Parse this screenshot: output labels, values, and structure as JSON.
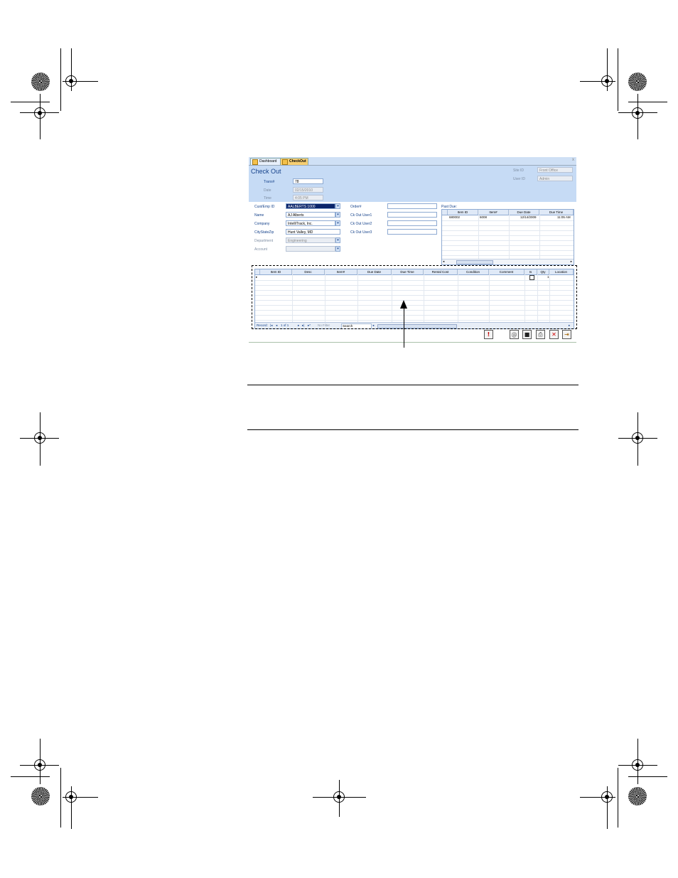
{
  "tabs": [
    {
      "label": "Dashboard"
    },
    {
      "label": "CheckOut"
    }
  ],
  "window": {
    "close": "x"
  },
  "form": {
    "title": "Check Out",
    "trans_label": "Trans#",
    "trans_value": "78",
    "date_label": "Date",
    "date_value": "02/15/2010",
    "time_label": "Time",
    "time_value": "4:05 PM",
    "site_label": "Site ID",
    "site_value": "Front Office",
    "user_label": "User ID",
    "user_value": "Admin"
  },
  "customer": {
    "cust_label": "Cust/Emp ID",
    "cust_value": "AALBERTS 1000",
    "name_label": "Name",
    "name_value": "AJ Alberts",
    "company_label": "Company",
    "company_value": "IntelliTrack, Inc.",
    "city_label": "CityStateZip",
    "city_value": "Hunt Valley, MD",
    "dept_label": "Department",
    "dept_value": "Engineering",
    "account_label": "Account",
    "account_value": ""
  },
  "order": {
    "order_label": "Order#",
    "user1_label": "Ck Out User1",
    "user2_label": "Ck Out User2",
    "user3_label": "Ck Out User3"
  },
  "pastdue": {
    "title": "Past Due:",
    "columns": [
      "Item ID",
      "Item#",
      "Due Date",
      "Due Time"
    ],
    "rows": [
      [
        "680002",
        "6008",
        "12/14/2009",
        "11:05 AM"
      ]
    ]
  },
  "main_grid": {
    "columns": [
      "Item ID",
      "Desc",
      "Item#",
      "Due Date",
      "Due Time",
      "Rental Cost",
      "Condition",
      "Comment",
      "Is",
      "Qty",
      "Location"
    ],
    "new_row_qty": "1",
    "nav": {
      "record_label": "Record:",
      "position": "1 of 1",
      "filter": "No Filter",
      "search": "Search"
    }
  },
  "glyphs": {
    "dropdown": "▾",
    "row_marker": "▸",
    "scroll_left": "◂",
    "scroll_right": "▸",
    "nav_first": "|◂",
    "nav_prev": "◂",
    "nav_next": "▸",
    "nav_last": "▸|",
    "nav_new": "▸*"
  },
  "buttons": [
    {
      "icon": "!"
    },
    {
      "icon": "@"
    },
    {
      "icon": "■"
    },
    {
      "icon": "⎙"
    },
    {
      "icon": "✕"
    },
    {
      "icon": "⇥"
    }
  ]
}
